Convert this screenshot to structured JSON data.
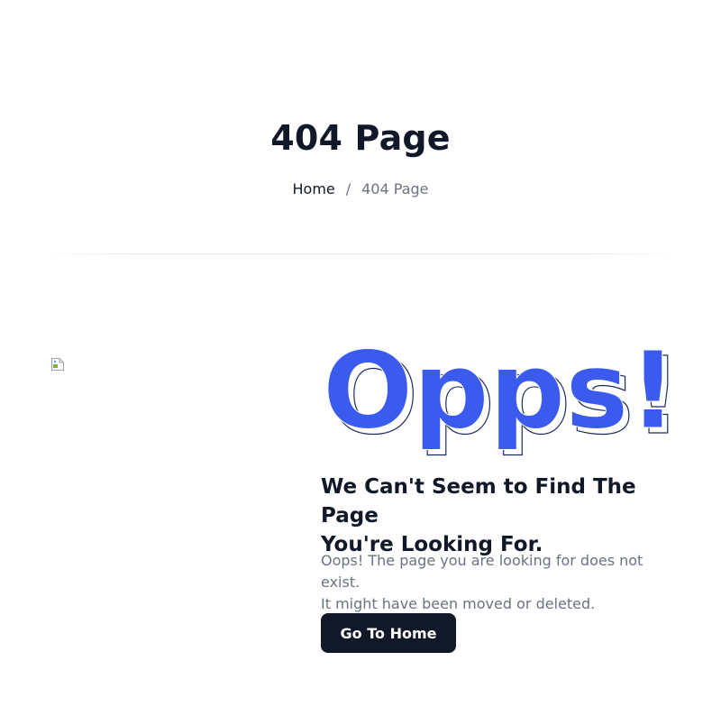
{
  "header": {
    "title": "404 Page",
    "breadcrumb": {
      "home": "Home",
      "separator": "/",
      "current": "404 Page"
    }
  },
  "main": {
    "illustration_icon": "broken-image-icon",
    "big_text": "Opps!",
    "heading_line1": "We Can't Seem to Find The Page",
    "heading_line2": "You're Looking For.",
    "description_line1": "Oops! The page you are looking for does not exist.",
    "description_line2": "It might have been moved or deleted.",
    "button_label": "Go To Home"
  },
  "colors": {
    "accent": "#3b5bef",
    "dark": "#111827",
    "muted": "#6b7280",
    "divider": "#e5e7eb"
  }
}
